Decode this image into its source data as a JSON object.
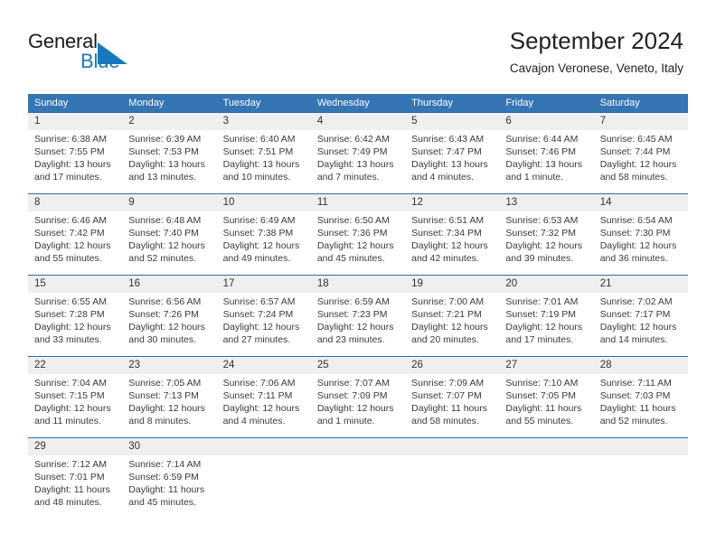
{
  "brand": {
    "name_part1": "General",
    "name_part2": "Blue",
    "accent_color": "#1878bd",
    "logo_icon": "triangle-flag-icon"
  },
  "header": {
    "title": "September 2024",
    "subtitle": "Cavajon Veronese, Veneto, Italy"
  },
  "calendar": {
    "header_bg": "#3575b4",
    "daynum_band_bg": "#efefef",
    "row_divider_color": "#2f6cab",
    "weekdays": [
      "Sunday",
      "Monday",
      "Tuesday",
      "Wednesday",
      "Thursday",
      "Friday",
      "Saturday"
    ],
    "weeks": [
      [
        {
          "day": "1",
          "sunrise": "Sunrise: 6:38 AM",
          "sunset": "Sunset: 7:55 PM",
          "daylight1": "Daylight: 13 hours",
          "daylight2": "and 17 minutes."
        },
        {
          "day": "2",
          "sunrise": "Sunrise: 6:39 AM",
          "sunset": "Sunset: 7:53 PM",
          "daylight1": "Daylight: 13 hours",
          "daylight2": "and 13 minutes."
        },
        {
          "day": "3",
          "sunrise": "Sunrise: 6:40 AM",
          "sunset": "Sunset: 7:51 PM",
          "daylight1": "Daylight: 13 hours",
          "daylight2": "and 10 minutes."
        },
        {
          "day": "4",
          "sunrise": "Sunrise: 6:42 AM",
          "sunset": "Sunset: 7:49 PM",
          "daylight1": "Daylight: 13 hours",
          "daylight2": "and 7 minutes."
        },
        {
          "day": "5",
          "sunrise": "Sunrise: 6:43 AM",
          "sunset": "Sunset: 7:47 PM",
          "daylight1": "Daylight: 13 hours",
          "daylight2": "and 4 minutes."
        },
        {
          "day": "6",
          "sunrise": "Sunrise: 6:44 AM",
          "sunset": "Sunset: 7:46 PM",
          "daylight1": "Daylight: 13 hours",
          "daylight2": "and 1 minute."
        },
        {
          "day": "7",
          "sunrise": "Sunrise: 6:45 AM",
          "sunset": "Sunset: 7:44 PM",
          "daylight1": "Daylight: 12 hours",
          "daylight2": "and 58 minutes."
        }
      ],
      [
        {
          "day": "8",
          "sunrise": "Sunrise: 6:46 AM",
          "sunset": "Sunset: 7:42 PM",
          "daylight1": "Daylight: 12 hours",
          "daylight2": "and 55 minutes."
        },
        {
          "day": "9",
          "sunrise": "Sunrise: 6:48 AM",
          "sunset": "Sunset: 7:40 PM",
          "daylight1": "Daylight: 12 hours",
          "daylight2": "and 52 minutes."
        },
        {
          "day": "10",
          "sunrise": "Sunrise: 6:49 AM",
          "sunset": "Sunset: 7:38 PM",
          "daylight1": "Daylight: 12 hours",
          "daylight2": "and 49 minutes."
        },
        {
          "day": "11",
          "sunrise": "Sunrise: 6:50 AM",
          "sunset": "Sunset: 7:36 PM",
          "daylight1": "Daylight: 12 hours",
          "daylight2": "and 45 minutes."
        },
        {
          "day": "12",
          "sunrise": "Sunrise: 6:51 AM",
          "sunset": "Sunset: 7:34 PM",
          "daylight1": "Daylight: 12 hours",
          "daylight2": "and 42 minutes."
        },
        {
          "day": "13",
          "sunrise": "Sunrise: 6:53 AM",
          "sunset": "Sunset: 7:32 PM",
          "daylight1": "Daylight: 12 hours",
          "daylight2": "and 39 minutes."
        },
        {
          "day": "14",
          "sunrise": "Sunrise: 6:54 AM",
          "sunset": "Sunset: 7:30 PM",
          "daylight1": "Daylight: 12 hours",
          "daylight2": "and 36 minutes."
        }
      ],
      [
        {
          "day": "15",
          "sunrise": "Sunrise: 6:55 AM",
          "sunset": "Sunset: 7:28 PM",
          "daylight1": "Daylight: 12 hours",
          "daylight2": "and 33 minutes."
        },
        {
          "day": "16",
          "sunrise": "Sunrise: 6:56 AM",
          "sunset": "Sunset: 7:26 PM",
          "daylight1": "Daylight: 12 hours",
          "daylight2": "and 30 minutes."
        },
        {
          "day": "17",
          "sunrise": "Sunrise: 6:57 AM",
          "sunset": "Sunset: 7:24 PM",
          "daylight1": "Daylight: 12 hours",
          "daylight2": "and 27 minutes."
        },
        {
          "day": "18",
          "sunrise": "Sunrise: 6:59 AM",
          "sunset": "Sunset: 7:23 PM",
          "daylight1": "Daylight: 12 hours",
          "daylight2": "and 23 minutes."
        },
        {
          "day": "19",
          "sunrise": "Sunrise: 7:00 AM",
          "sunset": "Sunset: 7:21 PM",
          "daylight1": "Daylight: 12 hours",
          "daylight2": "and 20 minutes."
        },
        {
          "day": "20",
          "sunrise": "Sunrise: 7:01 AM",
          "sunset": "Sunset: 7:19 PM",
          "daylight1": "Daylight: 12 hours",
          "daylight2": "and 17 minutes."
        },
        {
          "day": "21",
          "sunrise": "Sunrise: 7:02 AM",
          "sunset": "Sunset: 7:17 PM",
          "daylight1": "Daylight: 12 hours",
          "daylight2": "and 14 minutes."
        }
      ],
      [
        {
          "day": "22",
          "sunrise": "Sunrise: 7:04 AM",
          "sunset": "Sunset: 7:15 PM",
          "daylight1": "Daylight: 12 hours",
          "daylight2": "and 11 minutes."
        },
        {
          "day": "23",
          "sunrise": "Sunrise: 7:05 AM",
          "sunset": "Sunset: 7:13 PM",
          "daylight1": "Daylight: 12 hours",
          "daylight2": "and 8 minutes."
        },
        {
          "day": "24",
          "sunrise": "Sunrise: 7:06 AM",
          "sunset": "Sunset: 7:11 PM",
          "daylight1": "Daylight: 12 hours",
          "daylight2": "and 4 minutes."
        },
        {
          "day": "25",
          "sunrise": "Sunrise: 7:07 AM",
          "sunset": "Sunset: 7:09 PM",
          "daylight1": "Daylight: 12 hours",
          "daylight2": "and 1 minute."
        },
        {
          "day": "26",
          "sunrise": "Sunrise: 7:09 AM",
          "sunset": "Sunset: 7:07 PM",
          "daylight1": "Daylight: 11 hours",
          "daylight2": "and 58 minutes."
        },
        {
          "day": "27",
          "sunrise": "Sunrise: 7:10 AM",
          "sunset": "Sunset: 7:05 PM",
          "daylight1": "Daylight: 11 hours",
          "daylight2": "and 55 minutes."
        },
        {
          "day": "28",
          "sunrise": "Sunrise: 7:11 AM",
          "sunset": "Sunset: 7:03 PM",
          "daylight1": "Daylight: 11 hours",
          "daylight2": "and 52 minutes."
        }
      ],
      [
        {
          "day": "29",
          "sunrise": "Sunrise: 7:12 AM",
          "sunset": "Sunset: 7:01 PM",
          "daylight1": "Daylight: 11 hours",
          "daylight2": "and 48 minutes."
        },
        {
          "day": "30",
          "sunrise": "Sunrise: 7:14 AM",
          "sunset": "Sunset: 6:59 PM",
          "daylight1": "Daylight: 11 hours",
          "daylight2": "and 45 minutes."
        },
        {
          "day": "",
          "sunrise": "",
          "sunset": "",
          "daylight1": "",
          "daylight2": ""
        },
        {
          "day": "",
          "sunrise": "",
          "sunset": "",
          "daylight1": "",
          "daylight2": ""
        },
        {
          "day": "",
          "sunrise": "",
          "sunset": "",
          "daylight1": "",
          "daylight2": ""
        },
        {
          "day": "",
          "sunrise": "",
          "sunset": "",
          "daylight1": "",
          "daylight2": ""
        },
        {
          "day": "",
          "sunrise": "",
          "sunset": "",
          "daylight1": "",
          "daylight2": ""
        }
      ]
    ]
  }
}
